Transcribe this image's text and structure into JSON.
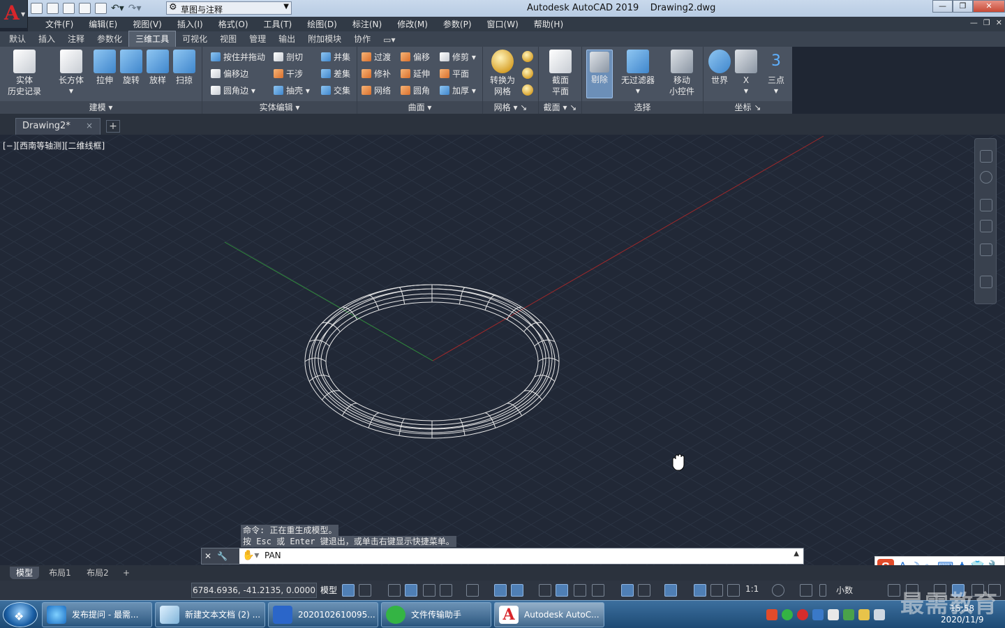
{
  "title_bar": {
    "app_title": "Autodesk AutoCAD 2019    Drawing2.dwg",
    "workspace": "草图与注释",
    "logo_letter": "A"
  },
  "menu": [
    "文件(F)",
    "编辑(E)",
    "视图(V)",
    "插入(I)",
    "格式(O)",
    "工具(T)",
    "绘图(D)",
    "标注(N)",
    "修改(M)",
    "参数(P)",
    "窗口(W)",
    "帮助(H)"
  ],
  "ribbon_tabs": [
    "默认",
    "插入",
    "注释",
    "参数化",
    "三维工具",
    "可视化",
    "视图",
    "管理",
    "输出",
    "附加模块",
    "协作"
  ],
  "ribbon_active_tab": "三维工具",
  "ribbon": {
    "modeling": {
      "title": "建模",
      "history": "实体\n历史记录",
      "box": "长方体",
      "extrude": "拉伸",
      "revolve": "旋转",
      "loft": "放样",
      "sweep": "扫掠"
    },
    "solid_edit": {
      "title": "实体编辑",
      "presspull": "按住并拖动",
      "offset_edge": "偏移边",
      "fillet_edge": "圆角边",
      "slice": "剖切",
      "interfere": "干涉",
      "shell": "抽壳",
      "union": "并集",
      "subtract": "差集",
      "intersect": "交集"
    },
    "surface": {
      "title": "曲面",
      "blend": "过渡",
      "patch": "修补",
      "network": "网络",
      "offset": "偏移",
      "extend": "延伸",
      "fillet": "圆角",
      "trim": "修剪",
      "planar": "平面",
      "thicken": "加厚"
    },
    "mesh": {
      "title": "网格",
      "convert": "转换为\n网格"
    },
    "section": {
      "title": "截面",
      "plane": "截面\n平面"
    },
    "selection": {
      "title": "选择",
      "cull": "剔除",
      "no_filter": "无过滤器",
      "gizmo": "移动\n小控件"
    },
    "coordinates": {
      "title": "坐标",
      "world": "世界",
      "x": "X",
      "three_point": "三点"
    }
  },
  "doc_tab": {
    "name": "Drawing2*",
    "close": "×",
    "new": "+"
  },
  "viewport": {
    "label": "[−][西南等轴测][二维线框]"
  },
  "command": {
    "history": [
      "命令: 正在重生成模型。",
      "按 Esc 或 Enter 键退出，或单击右键显示快捷菜单。"
    ],
    "current": "PAN"
  },
  "layout_tabs": [
    "模型",
    "布局1",
    "布局2"
  ],
  "status": {
    "coords": "6784.6936, -41.2135, 0.0000",
    "model": "模型",
    "scale": "1:1",
    "units": "小数"
  },
  "taskbar": {
    "tasks": [
      "发布提问 - 最需...",
      "新建文本文档 (2) ...",
      "2020102610095...",
      "文件传输助手",
      "Autodesk AutoC..."
    ],
    "time": "15:58",
    "date": "2020/11/9"
  },
  "watermark": "最需教育",
  "colors": {
    "viewport_bg": "#212836",
    "x_axis": "#a0282a",
    "y_axis": "#2f8a3a",
    "wireframe": "#e8e8e8"
  }
}
